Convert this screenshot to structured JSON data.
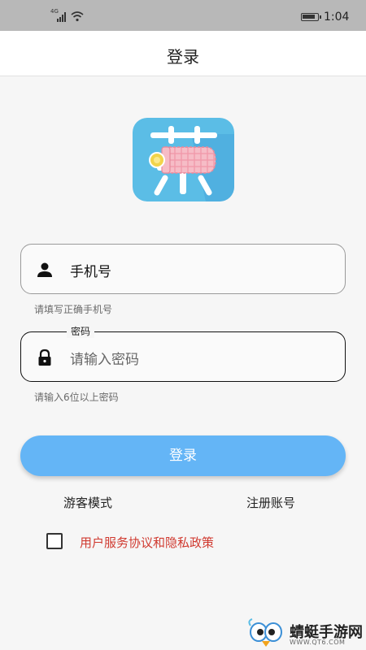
{
  "status_bar": {
    "time": "1:04",
    "network": "4G",
    "icons": [
      "signal-icon",
      "wifi-icon",
      "battery-icon"
    ]
  },
  "header": {
    "title": "登录"
  },
  "logo": {
    "glyph": "蒜",
    "colors": {
      "background": "#5bbde6",
      "pouch": "#f5b8c3",
      "coin": "#f2d44a"
    }
  },
  "phone_field": {
    "icon": "person-icon",
    "value": "手机号",
    "helper": "请填写正确手机号"
  },
  "password_field": {
    "icon": "lock-icon",
    "label": "密码",
    "placeholder": "请输入密码",
    "helper": "请输入6位以上密码"
  },
  "login_button": {
    "label": "登录",
    "color": "#64b5f6"
  },
  "links": {
    "guest": "游客模式",
    "register": "注册账号"
  },
  "agreement": {
    "checked": false,
    "text": "用户服务协议和隐私政策",
    "color": "#d03a30"
  },
  "watermark": {
    "name": "蜻蜓手游网",
    "url": "WWW.QT6.COM"
  }
}
